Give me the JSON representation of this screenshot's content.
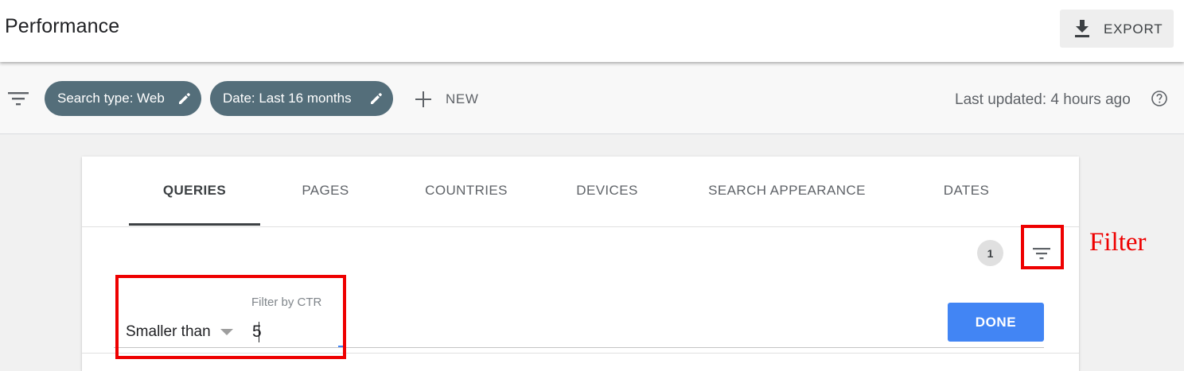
{
  "header": {
    "title": "Performance",
    "export_label": "EXPORT"
  },
  "filter_bar": {
    "chips": [
      {
        "label": "Search type: Web"
      },
      {
        "label": "Date: Last 16 months"
      }
    ],
    "new_label": "NEW",
    "last_updated": "Last updated: 4 hours ago"
  },
  "tabs": [
    {
      "label": "QUERIES",
      "active": true
    },
    {
      "label": "PAGES",
      "active": false
    },
    {
      "label": "COUNTRIES",
      "active": false
    },
    {
      "label": "DEVICES",
      "active": false
    },
    {
      "label": "SEARCH APPEARANCE",
      "active": false
    },
    {
      "label": "DATES",
      "active": false
    }
  ],
  "filter_panel": {
    "active_filter_count": "1",
    "field_label": "Filter by CTR",
    "operator": "Smaller than",
    "value": "5",
    "done_label": "DONE"
  },
  "annotation": {
    "label": "Filter",
    "color": "#ee0000"
  },
  "colors": {
    "chip_bg": "#546e7a",
    "primary_button": "#4285f4"
  },
  "icons": [
    "download-icon",
    "filter-list-icon",
    "pencil-icon",
    "plus-icon",
    "help-circle-icon",
    "dropdown-caret-icon"
  ]
}
